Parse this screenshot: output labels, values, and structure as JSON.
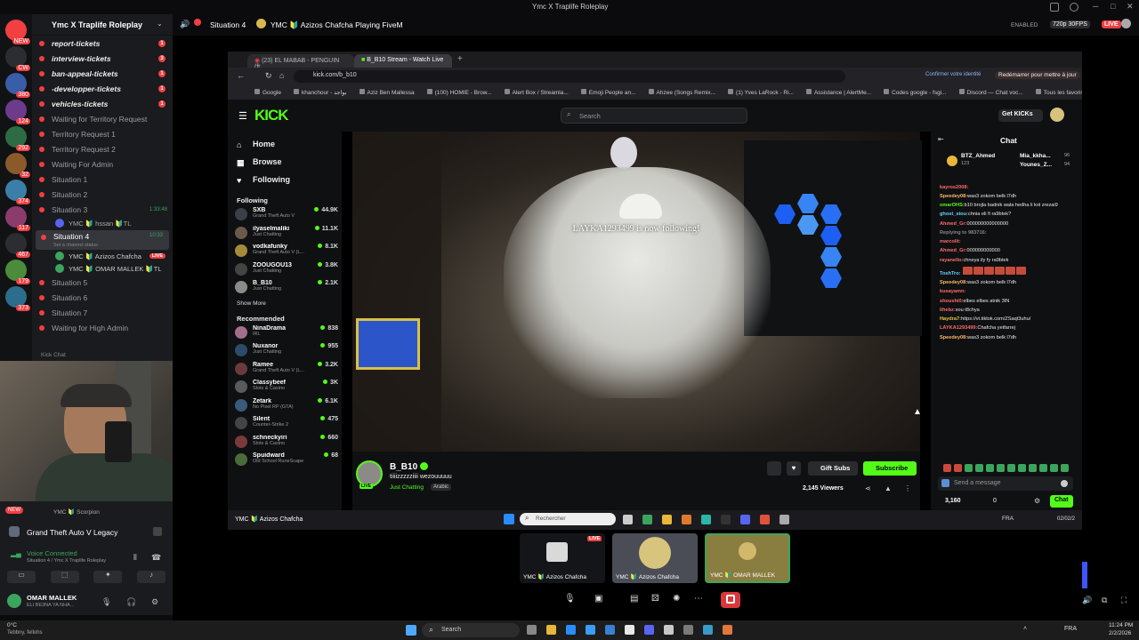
{
  "window": {
    "title": "Ymc X Traplife Roleplay",
    "controls": [
      "─",
      "□",
      "✕"
    ]
  },
  "topbar": {
    "server": "Ymc X Traplife Roleplay",
    "channel": "Situation 4",
    "stream_title": "YMC 🔰 Azizos Chafcha Playing FiveM",
    "enabled": "ENABLED",
    "quality": "720p 30FPS",
    "live": "LIVE"
  },
  "guildbar": {
    "items": [
      {
        "badge": "NEW"
      },
      {
        "badge": "CW"
      },
      {
        "badge": "380"
      },
      {
        "badge": "124"
      },
      {
        "badge": "292"
      },
      {
        "badge": "32"
      },
      {
        "badge": "374"
      },
      {
        "badge": "117"
      },
      {
        "badge": "467"
      },
      {
        "badge": "179"
      },
      {
        "badge": "373"
      }
    ]
  },
  "channels": {
    "header": "Ymc X Traplife Roleplay",
    "items": [
      {
        "label": "report-tickets",
        "bold": true,
        "badge": "1"
      },
      {
        "label": "interview-tickets",
        "bold": true,
        "badge": "3"
      },
      {
        "label": "ban-appeal-tickets",
        "bold": true,
        "badge": "1"
      },
      {
        "label": "-developper-tickets",
        "bold": true,
        "badge": "1"
      },
      {
        "label": "vehicles-tickets",
        "bold": true,
        "badge": "1"
      },
      {
        "label": "Waiting for Territory Request",
        "bold": false,
        "badge": ""
      },
      {
        "label": "Territory Request 1",
        "bold": false,
        "badge": ""
      },
      {
        "label": "Territory Request 2",
        "bold": false,
        "badge": ""
      },
      {
        "label": "Waiting For Admin",
        "bold": false,
        "badge": ""
      },
      {
        "label": "Situation 1",
        "bold": false,
        "badge": ""
      },
      {
        "label": "Situation 2",
        "bold": false,
        "badge": ""
      },
      {
        "label": "Situation 3",
        "bold": false,
        "badge": "1:33:48"
      }
    ],
    "situation3_member": "YMC 🔰 hssan 🔰TL",
    "situation4": {
      "label": "Situation 4",
      "timer": "10:33",
      "subtitle": "Set a channel status"
    },
    "situation4_members": [
      {
        "name": "YMC 🔰 Azizos Chafcha",
        "live": "LIVE"
      },
      {
        "name": "YMC 🔰 OMAR MALLEK 🔰TL",
        "live": ""
      }
    ],
    "after": [
      {
        "label": "Situation 5"
      },
      {
        "label": "Situation 6"
      },
      {
        "label": "Situation 7"
      },
      {
        "label": "Waiting for High Admin"
      }
    ],
    "kick_chat": "Kick Chat"
  },
  "voice_panel": {
    "new_badge": "NEW",
    "member": "YMC 🔰 Scorpion",
    "game": "Grand Theft Auto V Legacy",
    "voice_status": "Voice Connected",
    "voice_location": "Situation 4 / Ymc X Traplife Roleplay",
    "user_name": "OMAR MALLEK",
    "user_status": "ELI BE3NA YA NHA..."
  },
  "browser": {
    "tabs": [
      {
        "label": "(23) EL MABAB - PENGUIN (ft..."
      },
      {
        "label": "B_B10 Stream - Watch Live"
      }
    ],
    "url": "kick.com/b_b10",
    "security": "Confirmer votre identité",
    "restart": "Redémarrer pour mettre à jour",
    "bookmarks": [
      "Google",
      "khanchour - بواجد",
      "Aziz Ben Mallessa",
      "(100) HOMIE - Brow...",
      "Alert Box / Streamla...",
      "Emoji People an...",
      "Ahzee (Songs Remix...",
      "(1) Yves LaRock - Ri...",
      "Assistance | AlertMe...",
      "Codes google - fsgi...",
      "Discord — Chat voc...",
      "Tous les favoris"
    ]
  },
  "kick": {
    "logo": "KICK",
    "search_placeholder": "Search",
    "get_kicks": "Get KICKs",
    "nav": [
      {
        "label": "Home",
        "icon": "home-icon"
      },
      {
        "label": "Browse",
        "icon": "browse-icon"
      },
      {
        "label": "Following",
        "icon": "heart-icon"
      }
    ],
    "following_title": "Following",
    "following": [
      {
        "name": "SXB",
        "category": "Grand Theft Auto V",
        "count": "44.9K"
      },
      {
        "name": "ilyaselmaliki",
        "category": "Just Chatting",
        "count": "11.1K"
      },
      {
        "name": "vodkafunky",
        "category": "Grand Theft Auto V (L...",
        "count": "8.1K"
      },
      {
        "name": "ZOOUGOU13",
        "category": "Just Chatting",
        "count": "3.8K"
      },
      {
        "name": "B_B10",
        "category": "Just Chatting",
        "count": "2.1K"
      }
    ],
    "show_more": "Show More",
    "recommended_title": "Recommended",
    "recommended": [
      {
        "name": "NinaDrama",
        "category": "IRL",
        "count": "838"
      },
      {
        "name": "Nuxanor",
        "category": "Just Chatting",
        "count": "955"
      },
      {
        "name": "Rameе",
        "category": "Grand Theft Auto V (L...",
        "count": "3.2K"
      },
      {
        "name": "Classybeef",
        "category": "Slots & Casino",
        "count": "3K"
      },
      {
        "name": "Zetark",
        "category": "No Pixel RP (GTA)",
        "count": "6.1K"
      },
      {
        "name": "Silent",
        "category": "Counter-Strike 2",
        "count": "475"
      },
      {
        "name": "schneckyiri",
        "category": "Slots & Casino",
        "count": "660"
      },
      {
        "name": "Spuidward",
        "category": "Old School RuneScape",
        "count": "68"
      }
    ],
    "overlay": "LAYKA1293499 is now following!",
    "streamer": {
      "name": "B_B10",
      "title": "tiiiizzzzziiii wezouuuuu",
      "category": "Just Chatting",
      "language": "Arabic",
      "viewers": "2,145 Viewers",
      "live_badge": "LIVE"
    },
    "gift_subs": "Gift Subs",
    "subscribe": "Subscribe",
    "chat": {
      "title": "Chat",
      "pinned": [
        {
          "name": "BTZ_Ahmed",
          "count": "123"
        },
        {
          "name": "Mia_kkha...",
          "count": "96"
        },
        {
          "name": "Younes_Z...",
          "count": "94"
        }
      ],
      "messages": [
        {
          "user": "kayros2008:",
          "text": "",
          "color": "#ff6a6a"
        },
        {
          "user": "Speedey08:",
          "text": "was3 zokom belk l7dh",
          "color": "#ffb86b"
        },
        {
          "user": "omarOHS:",
          "text": "b10 brojla badnik wala hedha li kol zrezai9",
          "color": "#53fc18"
        },
        {
          "user": "ghost_stou:",
          "text": "chnia eli fi ra9btek?",
          "color": "#6ad1ff"
        },
        {
          "user": "Ahmed_Gr:",
          "text": "000000000000000",
          "color": "#ff6a6a"
        },
        {
          "user": "Replying to 983716:",
          "text": "",
          "color": "#888"
        },
        {
          "user": "marcolit:",
          "text": "",
          "color": "#ff6a6a"
        },
        {
          "user": "Ahmed_Gr:",
          "text": "000000000000",
          "color": "#ff6a6a"
        },
        {
          "user": "rayanello:",
          "text": "chneya ily fy ra9btek",
          "color": "#ff6a6a"
        },
        {
          "user": "ToshTro:",
          "text": "",
          "color": "#6ad1ff"
        },
        {
          "user": "Speedey08:",
          "text": "was3 zokom belk l7dh",
          "color": "#ffb86b"
        },
        {
          "user": "kusayamn:",
          "text": "",
          "color": "#ff6a6a"
        },
        {
          "user": "shoushi0:",
          "text": "elbes elbes atnik 3IN",
          "color": "#ff6a6a"
        },
        {
          "user": "lihebz:",
          "text": "sou t8chya",
          "color": "#ff6a6a"
        },
        {
          "user": "Haydra7:",
          "text": "https://vt.tiktok.com/ZSaqt3uhu/",
          "color": "#e8c64b"
        },
        {
          "user": "LAYKA1293499:",
          "text": "Chafcha yetfarrej",
          "color": "#ff6a6a"
        },
        {
          "user": "Speedey08:",
          "text": "was3 zokom belk l7dh",
          "color": "#ffb86b"
        }
      ],
      "input_placeholder": "Send a message",
      "points": "3,160",
      "zero": "0",
      "send": "Chat"
    }
  },
  "inner_taskbar": {
    "app": "YMC 🔰 Azizos Chafcha",
    "search": "Rechercher",
    "lang": "FRA",
    "date": "02/02/2"
  },
  "participants": [
    {
      "name": "YMC 🔰 Azizos Chafcha",
      "live": "LIVE"
    },
    {
      "name": "YMC 🔰 Azizos Chafcha",
      "live": ""
    },
    {
      "name": "YMC 🔰 OMAR MALLEK",
      "live": ""
    }
  ],
  "taskbar": {
    "weather_temp": "0°C",
    "weather_desc": "Tebbny, fellohs",
    "search": "Search",
    "lang": "FRA",
    "time": "11:24 PM",
    "date": "2/2/2026"
  }
}
